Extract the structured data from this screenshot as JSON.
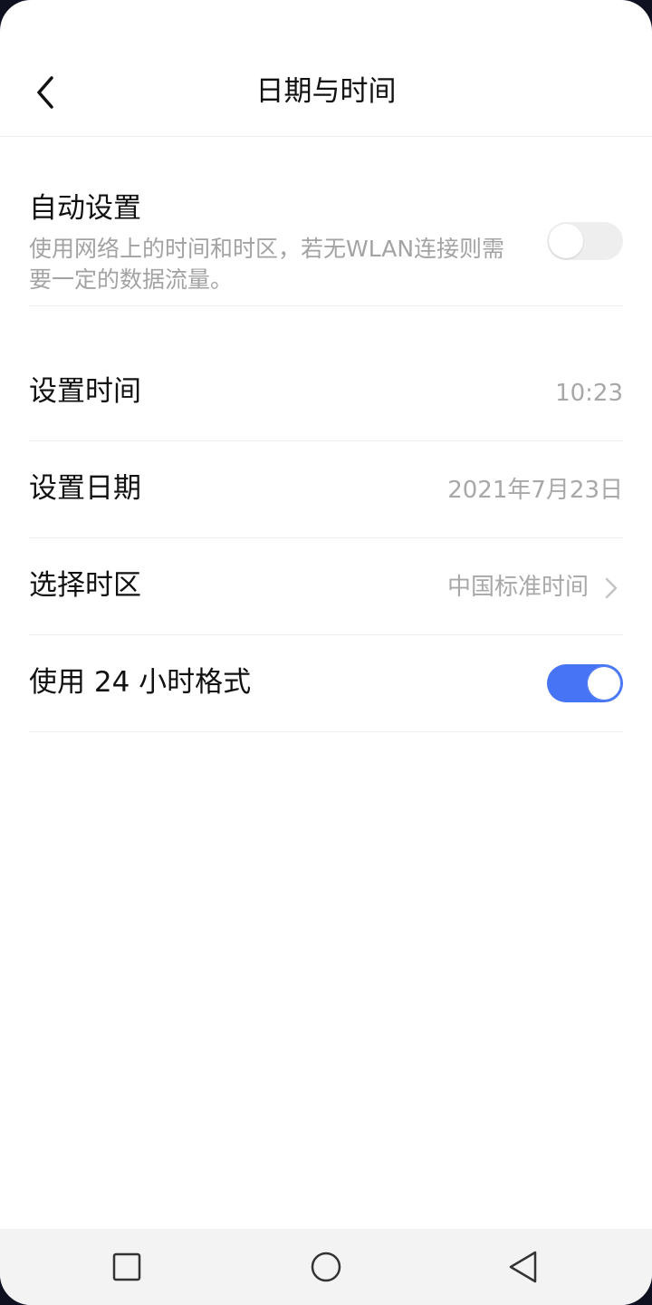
{
  "header": {
    "title": "日期与时间",
    "back_icon": "chevron-left-icon"
  },
  "settings": {
    "auto": {
      "title": "自动设置",
      "description": "使用网络上的时间和时区，若无WLAN连接则需要一定的数据流量。",
      "enabled": false
    },
    "set_time": {
      "title": "设置时间",
      "value": "10:23"
    },
    "set_date": {
      "title": "设置日期",
      "value": "2021年7月23日"
    },
    "timezone": {
      "title": "选择时区",
      "value": "中国标准时间"
    },
    "format_24h": {
      "title": "使用 24 小时格式",
      "enabled": true
    }
  },
  "colors": {
    "accent": "#4674f5",
    "toggle_off": "#eeeeee",
    "secondary_text": "#a3a3a3"
  },
  "navbar": {
    "recents_icon": "square-icon",
    "home_icon": "circle-icon",
    "back_icon": "triangle-back-icon"
  }
}
